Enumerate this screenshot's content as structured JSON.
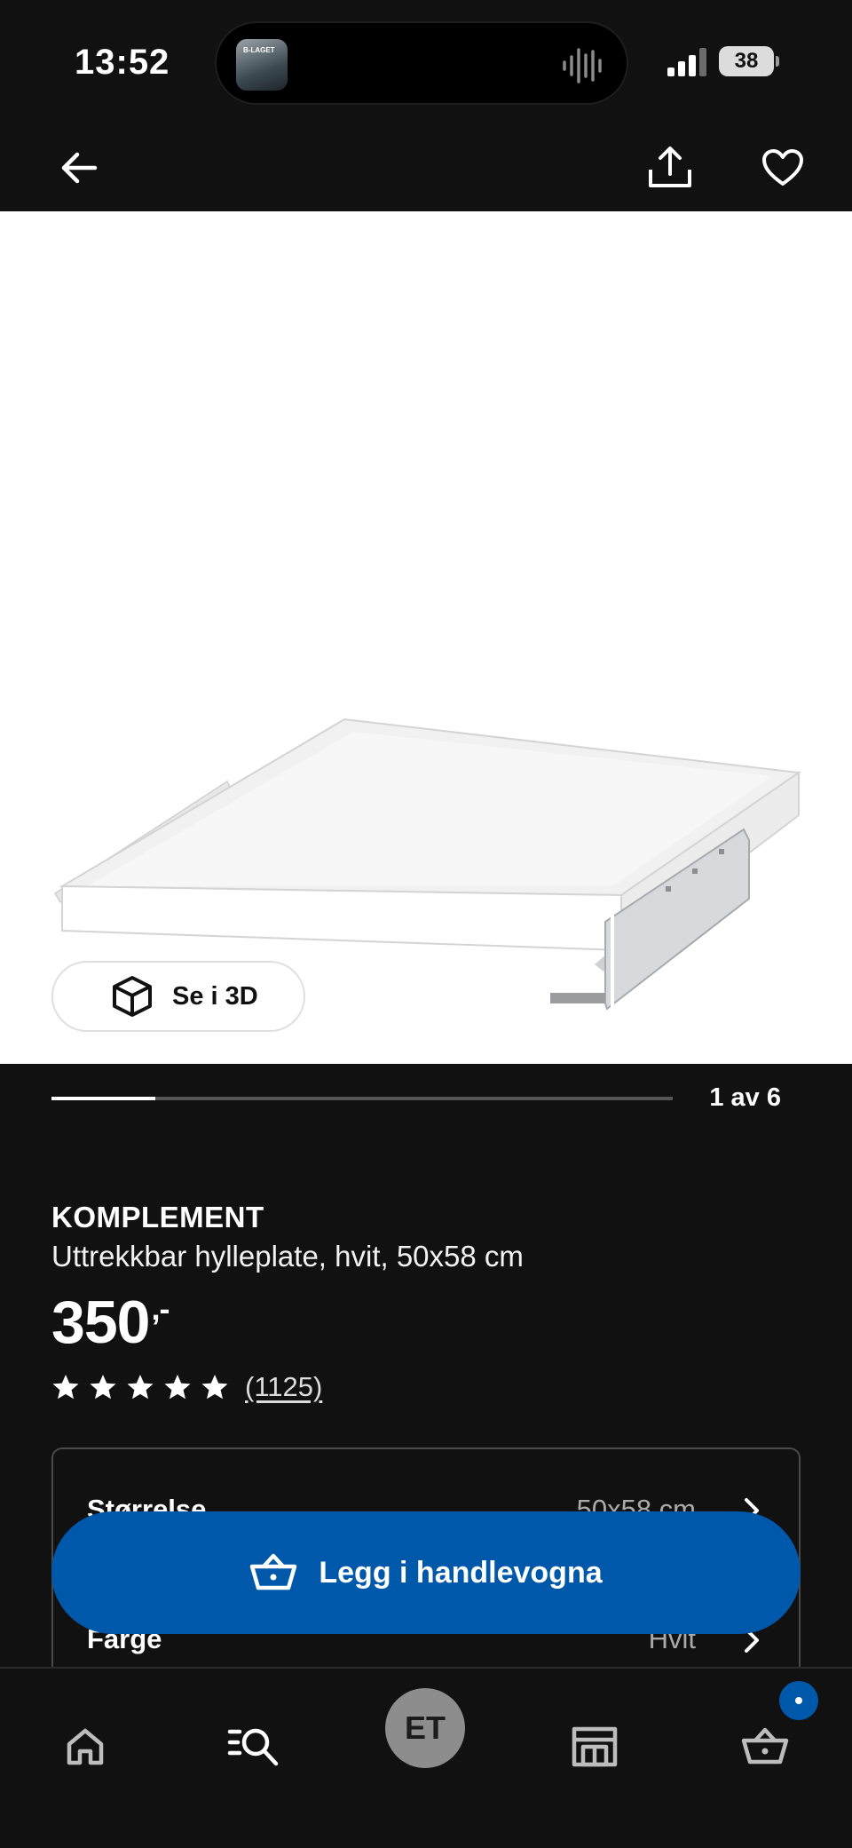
{
  "status_bar": {
    "time": "13:52",
    "now_playing_art_text": "B-LAGET",
    "battery": "38"
  },
  "top_nav": {
    "back_icon": "arrow-left-icon",
    "share_icon": "share-icon",
    "favorite_icon": "heart-icon"
  },
  "gallery": {
    "view_3d_label": "Se i 3D",
    "view_3d_icon": "cube-icon",
    "current_image": 1,
    "total_images": 6,
    "counter_text": "1 av 6"
  },
  "product": {
    "name": "KOMPLEMENT",
    "description": "Uttrekkbar hylleplate, hvit, 50x58 cm",
    "price": "350",
    "price_suffix": ",-",
    "rating_stars": 5,
    "review_count": "(1125)"
  },
  "options": [
    {
      "label": "Størrelse",
      "value": "50x58 cm"
    },
    {
      "label": "Farge",
      "value": "Hvit"
    }
  ],
  "cta": {
    "label": "Legg i handlevogna",
    "icon": "shopping-basket-icon",
    "color": "#0058ab"
  },
  "bottom_nav": {
    "home_icon": "home-icon",
    "search_icon": "search-list-icon",
    "avatar_initials": "ET",
    "store_icon": "store-icon",
    "cart_icon": "cart-icon"
  }
}
